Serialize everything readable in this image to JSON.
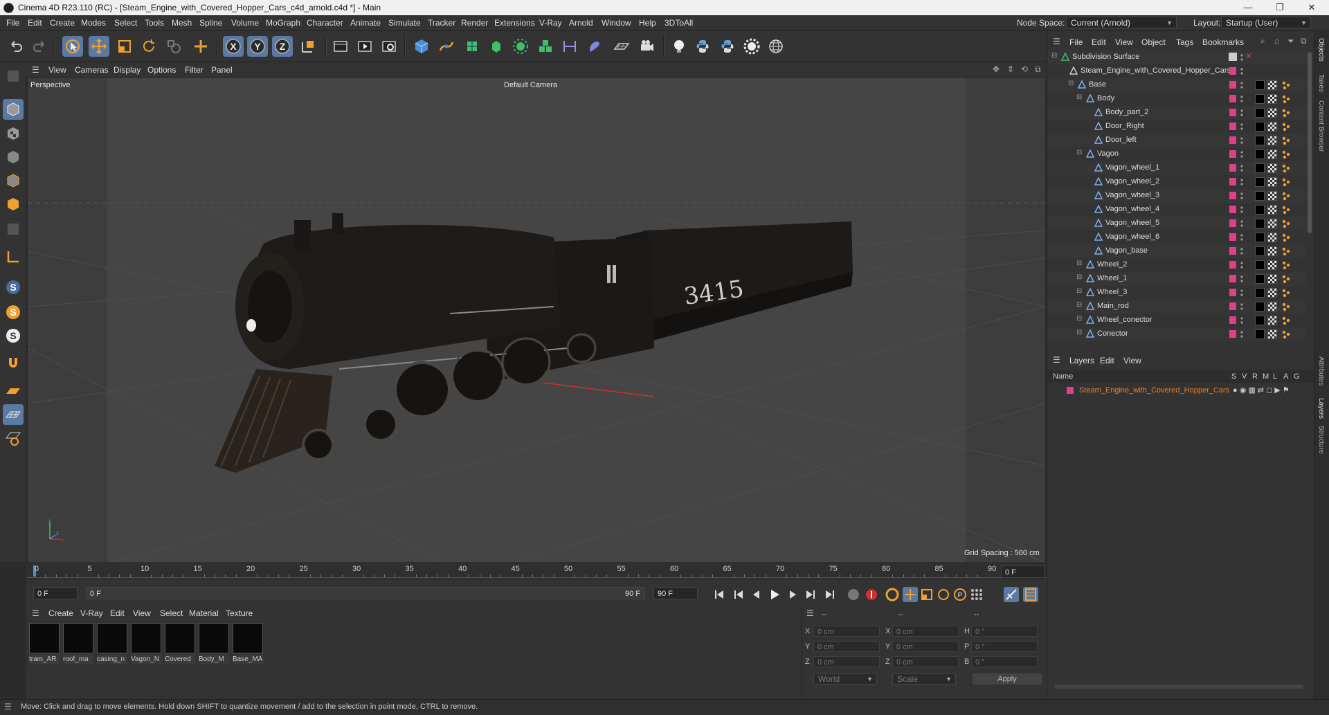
{
  "window": {
    "title": "Cinema 4D R23.110 (RC) - [Steam_Engine_with_Covered_Hopper_Cars_c4d_arnold.c4d *] - Main",
    "controls": [
      "—",
      "❐",
      "✕"
    ]
  },
  "menubar": {
    "items": [
      "File",
      "Edit",
      "Create",
      "Modes",
      "Select",
      "Tools",
      "Mesh",
      "Spline",
      "Volume",
      "MoGraph",
      "Character",
      "Animate",
      "Simulate",
      "Tracker",
      "Render",
      "Extensions",
      "V-Ray",
      "Arnold",
      "Window",
      "Help",
      "3DToAll"
    ],
    "node_space_label": "Node Space:",
    "node_space_value": "Current (Arnold)",
    "layout_label": "Layout:",
    "layout_value": "Startup (User)"
  },
  "toolbar": {
    "axis_x": "X",
    "axis_y": "Y",
    "axis_z": "Z",
    "icons": [
      "undo-icon",
      "redo-icon",
      "select-icon",
      "move-icon",
      "scale-icon",
      "rotate-icon",
      "live-select-icon",
      "add-icon",
      "x-axis-icon",
      "y-axis-icon",
      "z-axis-icon",
      "coordinate-system-icon",
      "render-view-icon",
      "render-icon",
      "render-settings-icon",
      "cube-icon",
      "pen-icon",
      "subdivision-icon",
      "extrude-icon",
      "cloner-icon",
      "mograph-icon",
      "symmetry-icon",
      "deformer-icon",
      "floor-icon",
      "camera-icon",
      "light-icon",
      "python-icon",
      "python2-icon",
      "gear-icon",
      "globe-icon"
    ]
  },
  "colors": {
    "accent_blue": "#5b7aa3",
    "tag_pink": "#e0408a",
    "layer_text_orange": "#e8812a",
    "axis_red": "#d03030"
  },
  "viewport": {
    "menu": [
      "View",
      "Cameras",
      "Display",
      "Options",
      "Filter",
      "Panel"
    ],
    "perspective_label": "Perspective",
    "camera_label": "Default Camera",
    "grid_spacing": "Grid Spacing : 500 cm",
    "train_number": "3415",
    "axis_x": "x",
    "axis_y": "y",
    "axis_z": "z"
  },
  "timeline": {
    "ticks": [
      "0",
      "5",
      "10",
      "15",
      "20",
      "25",
      "30",
      "35",
      "40",
      "45",
      "50",
      "55",
      "60",
      "65",
      "70",
      "75",
      "80",
      "85",
      "90"
    ],
    "current_frame_right": "0 F",
    "start_frame": "0 F",
    "range_start": "0 F",
    "range_end": "90 F",
    "end_frame": "90 F"
  },
  "material_manager": {
    "menu": [
      "Create",
      "V-Ray",
      "Edit",
      "View",
      "Select",
      "Material",
      "Texture"
    ],
    "materials": [
      "tram_AR",
      "roof_ma",
      "casing_n",
      "Vagon_N",
      "Covered",
      "Body_M",
      "Base_MA"
    ]
  },
  "coordinates": {
    "header": [
      "--",
      "--",
      "--"
    ],
    "rows": [
      {
        "l1": "X",
        "v1": "0 cm",
        "l2": "X",
        "v2": "0 cm",
        "l3": "H",
        "v3": "0 °"
      },
      {
        "l1": "Y",
        "v1": "0 cm",
        "l2": "Y",
        "v2": "0 cm",
        "l3": "P",
        "v3": "0 °"
      },
      {
        "l1": "Z",
        "v1": "0 cm",
        "l2": "Z",
        "v2": "0 cm",
        "l3": "B",
        "v3": "0 °"
      }
    ],
    "world": "World",
    "scale": "Scale",
    "apply": "Apply"
  },
  "status": {
    "text": "Move: Click and drag to move elements. Hold down SHIFT to quantize movement / add to the selection in point mode, CTRL to remove."
  },
  "object_manager": {
    "menu": [
      "File",
      "Edit",
      "View",
      "Object",
      "Tags",
      "Bookmarks"
    ],
    "items": [
      {
        "name": "Subdivision Surface",
        "level": 0
      },
      {
        "name": "Steam_Engine_with_Covered_Hopper_Cars",
        "level": 1
      },
      {
        "name": "Base",
        "level": 2
      },
      {
        "name": "Body",
        "level": 3
      },
      {
        "name": "Body_part_2",
        "level": 4
      },
      {
        "name": "Door_Right",
        "level": 4
      },
      {
        "name": "Door_left",
        "level": 4
      },
      {
        "name": "Vagon",
        "level": 3
      },
      {
        "name": "Vagon_wheel_1",
        "level": 4
      },
      {
        "name": "Vagon_wheel_2",
        "level": 4
      },
      {
        "name": "Vagon_wheel_3",
        "level": 4
      },
      {
        "name": "Vagon_wheel_4",
        "level": 4
      },
      {
        "name": "Vagon_wheel_5",
        "level": 4
      },
      {
        "name": "Vagon_wheel_6",
        "level": 4
      },
      {
        "name": "Vagon_base",
        "level": 4
      },
      {
        "name": "Wheel_2",
        "level": 3
      },
      {
        "name": "Wheel_1",
        "level": 3
      },
      {
        "name": "Wheel_3",
        "level": 3
      },
      {
        "name": "Main_rod",
        "level": 3
      },
      {
        "name": "Wheel_conector",
        "level": 3
      },
      {
        "name": "Conector",
        "level": 3
      }
    ]
  },
  "layers": {
    "menu": [
      "Layers",
      "Edit",
      "View"
    ],
    "name_header": "Name",
    "flags": [
      "S",
      "V",
      "R",
      "M",
      "L",
      "A",
      "G"
    ],
    "items": [
      "Steam_Engine_with_Covered_Hopper_Cars"
    ]
  },
  "right_tabs": [
    "Objects",
    "Takes",
    "Content Browser",
    "Attributes",
    "Layers",
    "Structure"
  ]
}
